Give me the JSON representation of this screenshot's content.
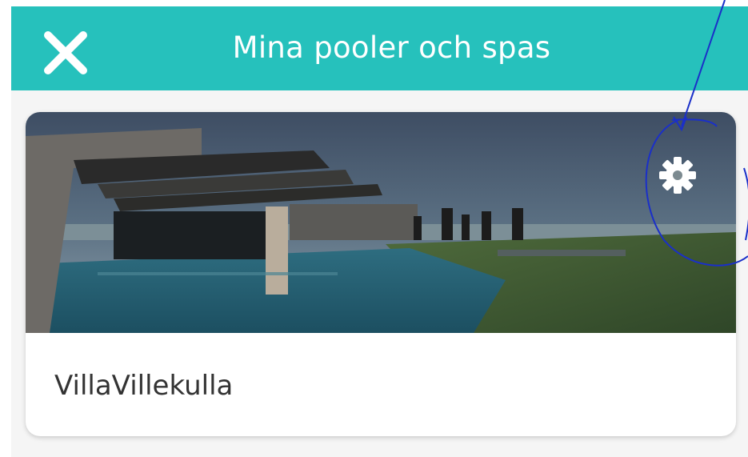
{
  "header": {
    "title": "Mina pooler och spas",
    "close_icon": "close-icon",
    "background_color": "#26c1bc"
  },
  "pools": [
    {
      "name": "VillaVillekulla",
      "settings_icon": "gear-icon"
    }
  ],
  "colors": {
    "accent": "#26c1bc",
    "annotation": "#1a2fc9",
    "text": "#333333"
  }
}
